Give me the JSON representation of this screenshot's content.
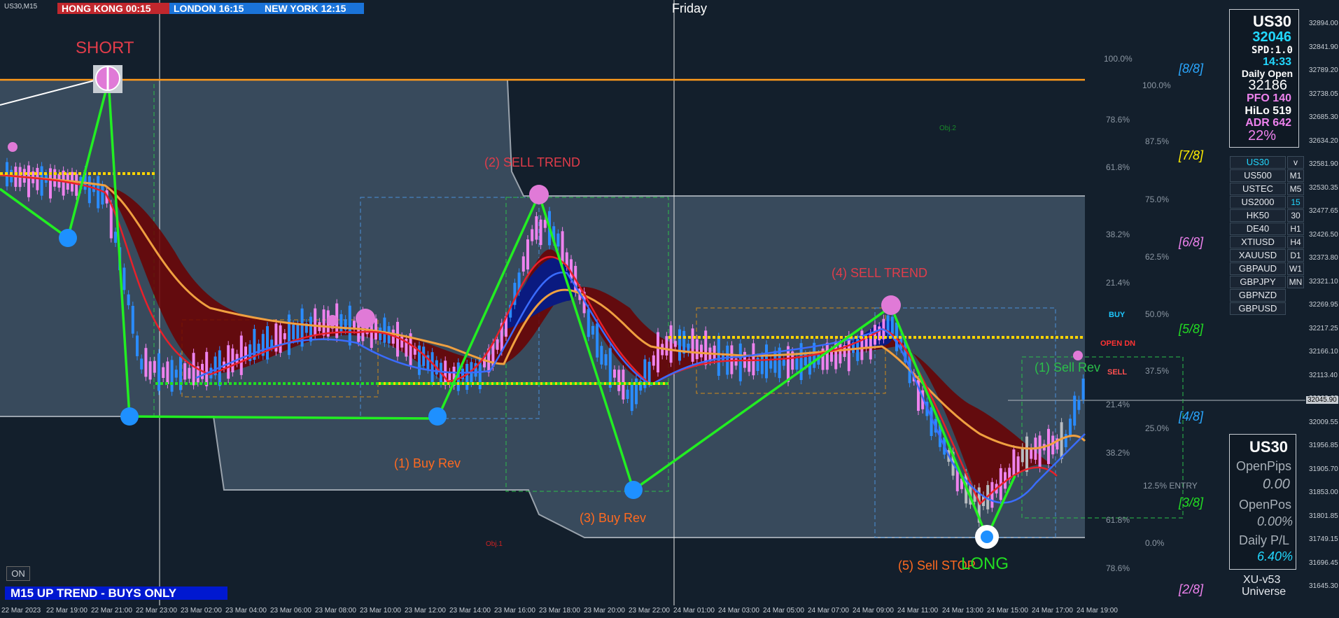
{
  "symbol_title": "US30,M15",
  "day_label": "Friday",
  "sessions": [
    {
      "label": "HONG KONG 00:15",
      "color": "#c1272d"
    },
    {
      "label": "LONDON  16:15",
      "color": "#1a73d9"
    },
    {
      "label": "NEW YORK 12:15",
      "color": "#1a73d9"
    }
  ],
  "annotations": {
    "short": "SHORT",
    "sell_trend_2": "(2) SELL TREND",
    "sell_trend_4": "(4) SELL TREND",
    "buy_rev_1": "(1) Buy Rev",
    "buy_rev_3": "(3) Buy Rev",
    "sell_rev_1": "(1) Sell Rev",
    "sell_stop_5": "(5) Sell STOP",
    "long": "LONG",
    "obj1": "Obj.1",
    "obj2": "Obj.2",
    "buy": "BUY",
    "sell": "SELL",
    "open_dn": "OPEN DN",
    "entry": "12.5% ENTRY"
  },
  "fib_left": [
    "100.0%",
    "78.6%",
    "61.8%",
    "38.2%",
    "21.4%",
    "21.4%",
    "38.2%",
    "61.8%",
    "78.6%"
  ],
  "fib_right": [
    "100.0%",
    "87.5%",
    "75.0%",
    "62.5%",
    "50.0%",
    "37.5%",
    "25.0%",
    "0.0%"
  ],
  "murrey": [
    {
      "label": "[8/8]",
      "color": "#2aa7ff"
    },
    {
      "label": "[7/8]",
      "color": "#ffee00"
    },
    {
      "label": "[6/8]",
      "color": "#ee82ee"
    },
    {
      "label": "[5/8]",
      "color": "#22dd22"
    },
    {
      "label": "[4/8]",
      "color": "#2aa7ff"
    },
    {
      "label": "[3/8]",
      "color": "#22dd22"
    },
    {
      "label": "[2/8]",
      "color": "#ee82ee"
    }
  ],
  "price_axis": [
    "32894.00",
    "32841.90",
    "32789.20",
    "32738.05",
    "32685.30",
    "32634.20",
    "32581.90",
    "32530.35",
    "32477.65",
    "32426.50",
    "32373.80",
    "32321.10",
    "32269.95",
    "32217.25",
    "32166.10",
    "32113.40",
    "32062.25",
    "32009.55",
    "31956.85",
    "31905.70",
    "31853.00",
    "31801.85",
    "31749.15",
    "31696.45",
    "31645.30"
  ],
  "current_price": "32045.90",
  "time_axis": [
    "22 Mar 2023",
    "22 Mar 19:00",
    "22 Mar 21:00",
    "22 Mar 23:00",
    "23 Mar 02:00",
    "23 Mar 04:00",
    "23 Mar 06:00",
    "23 Mar 08:00",
    "23 Mar 10:00",
    "23 Mar 12:00",
    "23 Mar 14:00",
    "23 Mar 16:00",
    "23 Mar 18:00",
    "23 Mar 20:00",
    "23 Mar 22:00",
    "24 Mar 01:00",
    "24 Mar 03:00",
    "24 Mar 05:00",
    "24 Mar 07:00",
    "24 Mar 09:00",
    "24 Mar 11:00",
    "24 Mar 13:00",
    "24 Mar 15:00",
    "24 Mar 17:00",
    "24 Mar 19:00"
  ],
  "info_panel": {
    "symbol": "US30",
    "price": "32046",
    "spread": "SPD:1.0",
    "timer": "14:33",
    "daily_open_label": "Daily Open",
    "daily_open": "32186",
    "pfo": "PFO 140",
    "hilo": "HiLo 519",
    "adr": "ADR 642",
    "adr_pct": "22%"
  },
  "symbols": [
    "US30",
    "US500",
    "USTEC",
    "US2000",
    "HK50",
    "DE40",
    "XTIUSD",
    "XAUUSD",
    "GBPAUD",
    "GBPJPY",
    "GBPNZD",
    "GBPUSD"
  ],
  "timeframes": [
    "v",
    "M1",
    "M5",
    "15",
    "30",
    "H1",
    "H4",
    "D1",
    "W1",
    "MN"
  ],
  "positions_panel": {
    "symbol": "US30",
    "open_pips_label": "OpenPips",
    "open_pips": "0.00",
    "open_pos_label": "OpenPos",
    "open_pos": "0.00%",
    "daily_pl_label": "Daily P/L",
    "daily_pl": "6.40%"
  },
  "version": "XU-v53",
  "universe": "Universe",
  "on_button": "ON",
  "trend_banner": "M15 UP TREND - BUYS ONLY"
}
